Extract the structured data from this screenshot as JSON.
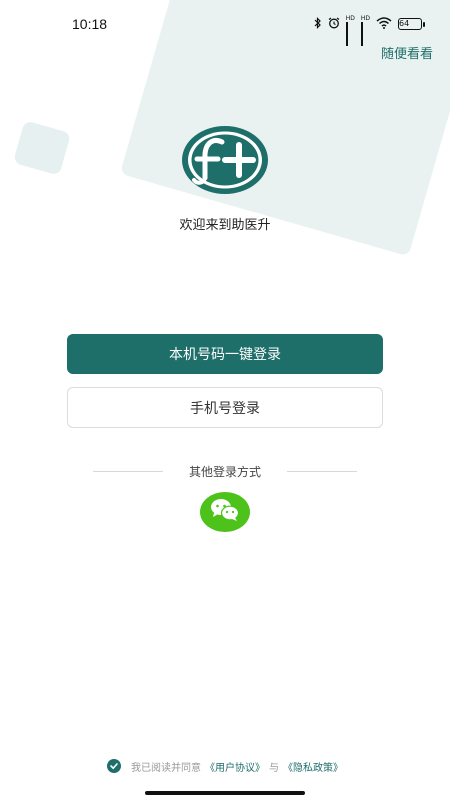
{
  "status_bar": {
    "time": "10:18",
    "hd1": "HD",
    "hd2": "HD",
    "battery": "64"
  },
  "header": {
    "skip_label": "随便看看"
  },
  "brand": {
    "welcome": "欢迎来到助医升",
    "color": "#1e6e6a"
  },
  "login": {
    "one_click_label": "本机号码一键登录",
    "phone_label": "手机号登录",
    "other_methods_label": "其他登录方式"
  },
  "agreement": {
    "prefix": "我已阅读并同意",
    "user_agreement": "《用户协议》",
    "and": "与",
    "privacy_policy": "《隐私政策》"
  },
  "icons": {
    "wechat": "wechat-icon",
    "check": "check-icon"
  }
}
